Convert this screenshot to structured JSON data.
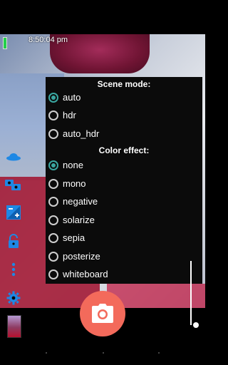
{
  "statusbar": {
    "time": "8:50:04 pm"
  },
  "scene_mode": {
    "title": "Scene mode:",
    "options": [
      {
        "label": "auto",
        "checked": true
      },
      {
        "label": "hdr",
        "checked": false
      },
      {
        "label": "auto_hdr",
        "checked": false
      }
    ]
  },
  "color_effect": {
    "title": "Color effect:",
    "options": [
      {
        "label": "none",
        "checked": true
      },
      {
        "label": "mono",
        "checked": false
      },
      {
        "label": "negative",
        "checked": false
      },
      {
        "label": "solarize",
        "checked": false
      },
      {
        "label": "sepia",
        "checked": false
      },
      {
        "label": "posterize",
        "checked": false
      },
      {
        "label": "whiteboard",
        "checked": false
      }
    ]
  },
  "colors": {
    "accent": "#3aa7a1",
    "shutter": "#f36a5b",
    "icon_blue": "#1e88e5"
  },
  "icons": [
    "popup-icon",
    "switch-camera-icon",
    "exposure-icon",
    "lock-icon",
    "more-icon",
    "settings-icon",
    "camera-icon"
  ]
}
